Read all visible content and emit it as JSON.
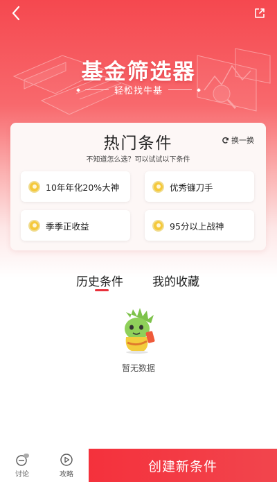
{
  "header": {
    "title": "基金筛选器",
    "subtitle": "轻松找牛基"
  },
  "hot_conditions": {
    "title": "热门条件",
    "refresh_label": "换一换",
    "hint": "不知道怎么选？可以试试以下条件",
    "items": [
      {
        "label": "10年年化20%大神"
      },
      {
        "label": "优秀镰刀手"
      },
      {
        "label": "季季正收益"
      },
      {
        "label": "95分以上战神"
      }
    ]
  },
  "tabs": {
    "history": "历史条件",
    "favorites": "我的收藏",
    "active": "history"
  },
  "empty": {
    "text": "暂无数据"
  },
  "bottom_bar": {
    "discuss_label": "讨论",
    "guide_label": "攻略",
    "create_label": "创建新条件"
  },
  "colors": {
    "accent": "#f4313c",
    "coin": "#f5c93b"
  }
}
